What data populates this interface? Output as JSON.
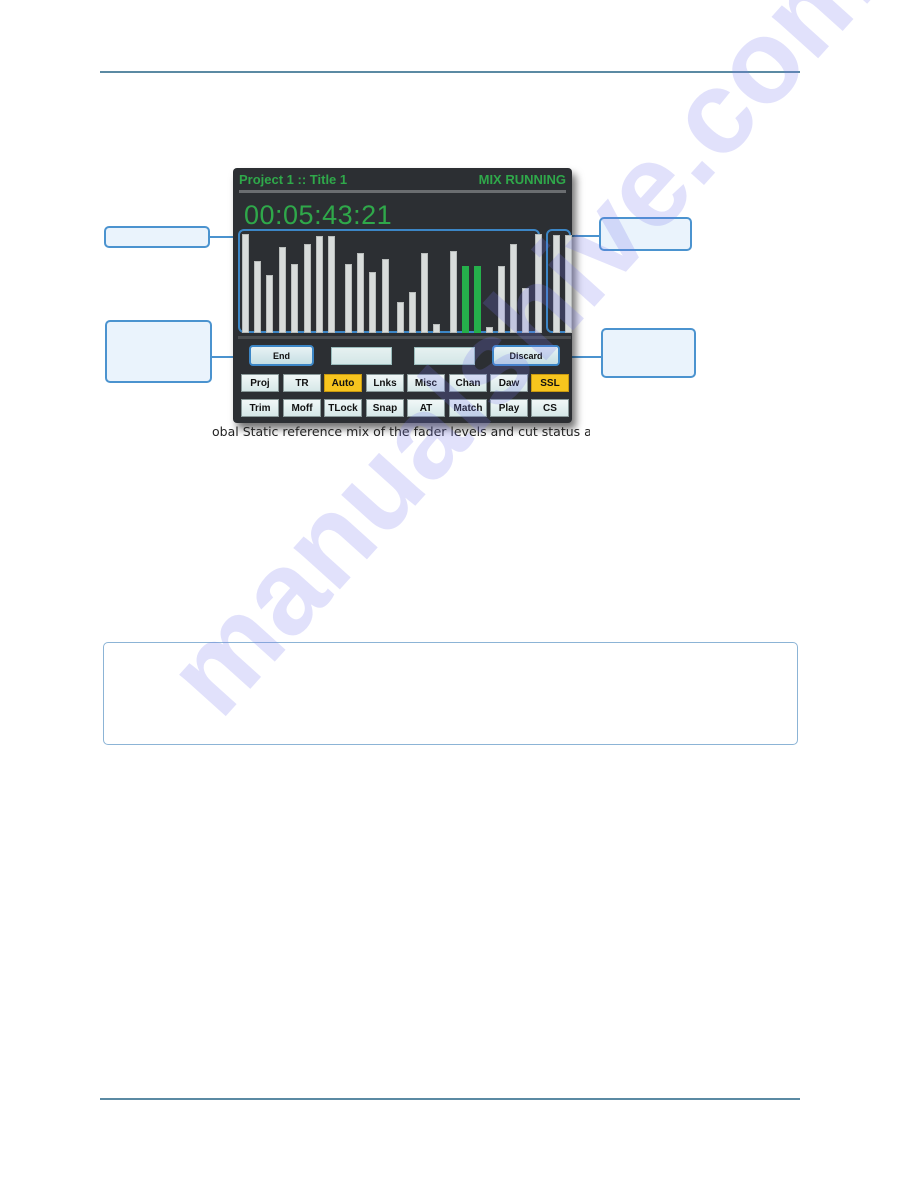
{
  "console": {
    "project_title": "Project 1  ::  Title 1",
    "mix_status": "MIX RUNNING",
    "timecode": "00:05:43:21",
    "accent_color": "#2fa84a",
    "fader_levels": [
      0.99,
      0.72,
      0.58,
      0.86,
      0.69,
      0.89,
      0.97,
      0.97,
      0.69,
      0.8,
      0.61,
      0.74,
      0.31,
      0.41,
      0.8,
      0.09,
      0.82,
      0.67,
      0.67,
      0.06,
      0.67,
      0.89,
      0.45,
      0.99
    ],
    "fader_active": [
      false,
      false,
      false,
      false,
      false,
      false,
      false,
      false,
      false,
      false,
      false,
      false,
      false,
      false,
      false,
      false,
      false,
      true,
      true,
      false,
      false,
      false,
      false,
      false
    ],
    "master_levels": [
      0.98,
      0.98
    ],
    "buttons": {
      "end": "End",
      "discard": "Discard"
    },
    "fields": [
      "",
      ""
    ],
    "softkeys_row1": [
      {
        "label": "Proj",
        "active": false
      },
      {
        "label": "TR",
        "active": false
      },
      {
        "label": "Auto",
        "active": true
      },
      {
        "label": "Lnks",
        "active": false
      },
      {
        "label": "Misc",
        "active": false
      },
      {
        "label": "Chan",
        "active": false
      },
      {
        "label": "Daw",
        "active": false
      },
      {
        "label": "SSL",
        "active": true
      }
    ],
    "softkeys_row2": [
      {
        "label": "Trim",
        "active": false
      },
      {
        "label": "Moff",
        "active": false
      },
      {
        "label": "TLock",
        "active": false
      },
      {
        "label": "Snap",
        "active": false
      },
      {
        "label": "AT",
        "active": false
      },
      {
        "label": "Match",
        "active": false
      },
      {
        "label": "Play",
        "active": false
      },
      {
        "label": "CS",
        "active": false
      }
    ]
  },
  "caption": "obal Static reference mix of the fader levels and cut status at the",
  "watermark": "manualshive.com"
}
